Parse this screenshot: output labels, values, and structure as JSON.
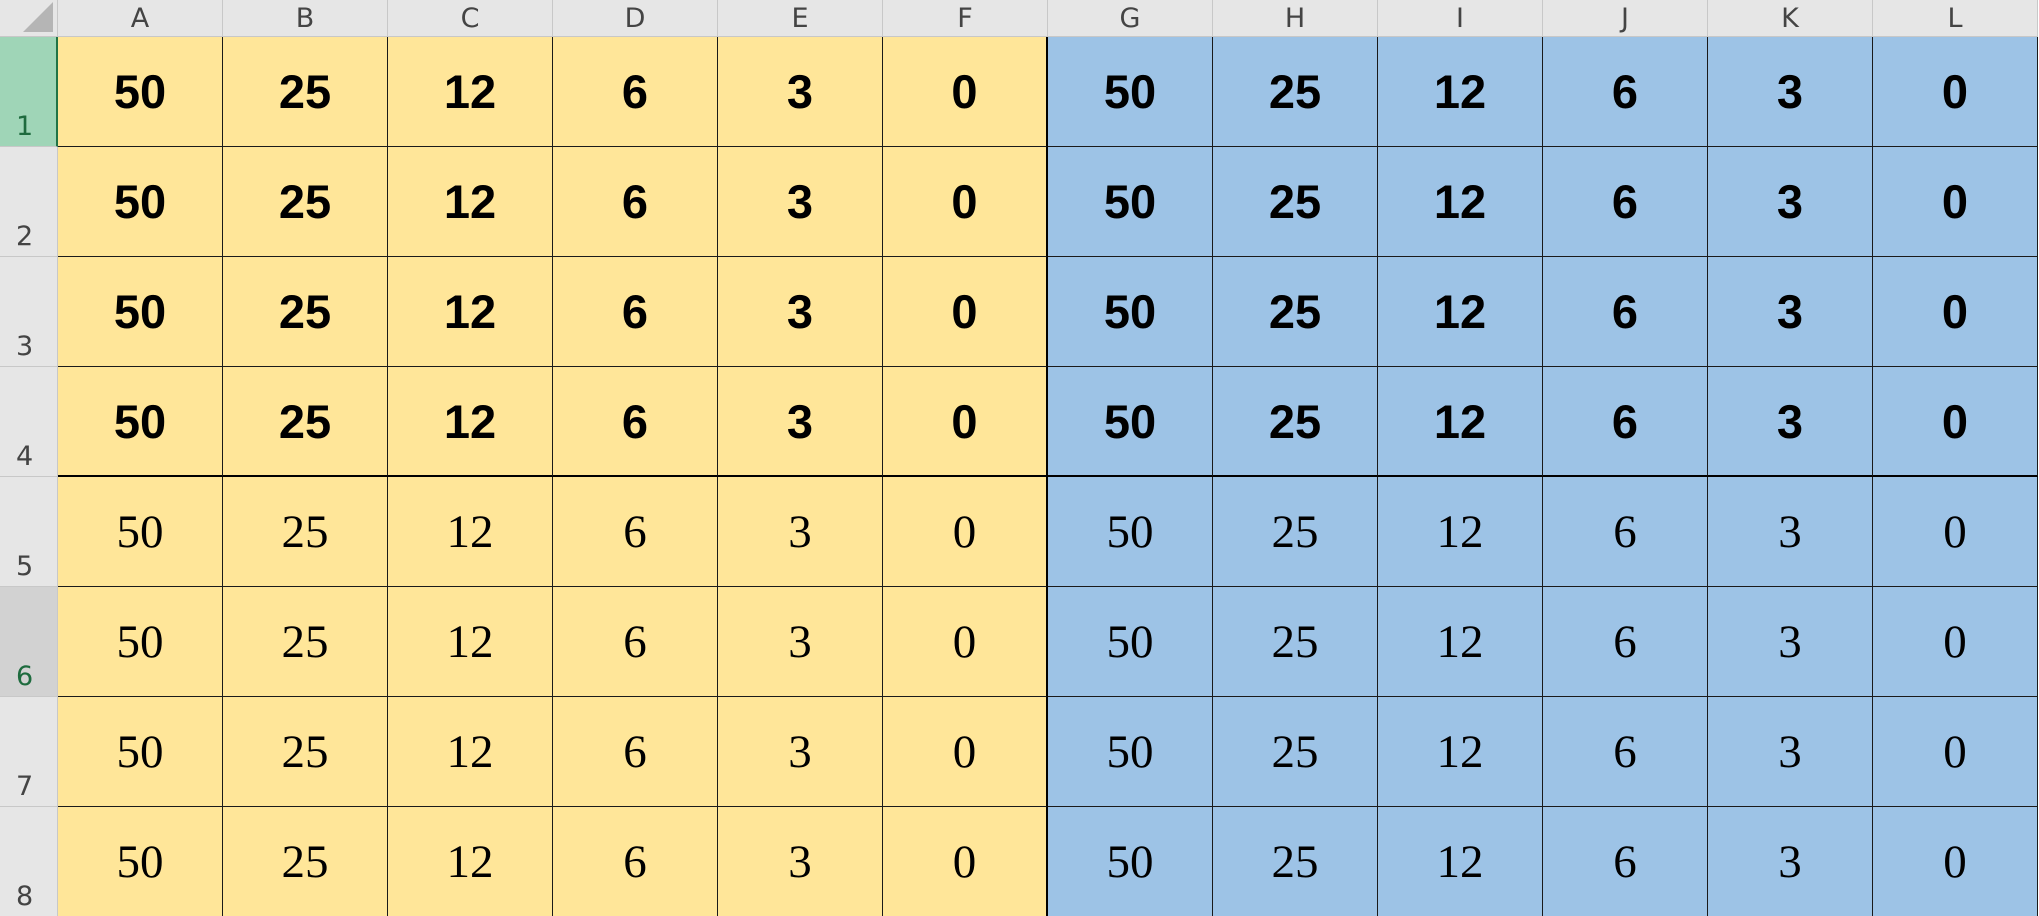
{
  "sheet": {
    "columns": [
      "A",
      "B",
      "C",
      "D",
      "E",
      "F",
      "G",
      "H",
      "I",
      "J",
      "K",
      "L"
    ],
    "rows": [
      {
        "label": "1",
        "style": "bold",
        "values": [
          "50",
          "25",
          "12",
          "6",
          "3",
          "0",
          "50",
          "25",
          "12",
          "6",
          "3",
          "0"
        ]
      },
      {
        "label": "2",
        "style": "bold",
        "values": [
          "50",
          "25",
          "12",
          "6",
          "3",
          "0",
          "50",
          "25",
          "12",
          "6",
          "3",
          "0"
        ]
      },
      {
        "label": "3",
        "style": "bold",
        "values": [
          "50",
          "25",
          "12",
          "6",
          "3",
          "0",
          "50",
          "25",
          "12",
          "6",
          "3",
          "0"
        ]
      },
      {
        "label": "4",
        "style": "bold",
        "values": [
          "50",
          "25",
          "12",
          "6",
          "3",
          "0",
          "50",
          "25",
          "12",
          "6",
          "3",
          "0"
        ]
      },
      {
        "label": "5",
        "style": "serif",
        "values": [
          "50",
          "25",
          "12",
          "6",
          "3",
          "0",
          "50",
          "25",
          "12",
          "6",
          "3",
          "0"
        ]
      },
      {
        "label": "6",
        "style": "serif",
        "values": [
          "50",
          "25",
          "12",
          "6",
          "3",
          "0",
          "50",
          "25",
          "12",
          "6",
          "3",
          "0"
        ]
      },
      {
        "label": "7",
        "style": "serif",
        "values": [
          "50",
          "25",
          "12",
          "6",
          "3",
          "0",
          "50",
          "25",
          "12",
          "6",
          "3",
          "0"
        ]
      },
      {
        "label": "8",
        "style": "serif",
        "values": [
          "50",
          "25",
          "12",
          "6",
          "3",
          "0",
          "50",
          "25",
          "12",
          "6",
          "3",
          "0"
        ]
      }
    ],
    "colors": {
      "left_fill": "#ffe699",
      "right_fill": "#9dc3e6",
      "header_fill": "#e6e6e6",
      "active_row_header": "#9fd5b7",
      "selected_row_header": "#d2d2d2"
    },
    "active_row": "1",
    "selected_row": "6"
  }
}
